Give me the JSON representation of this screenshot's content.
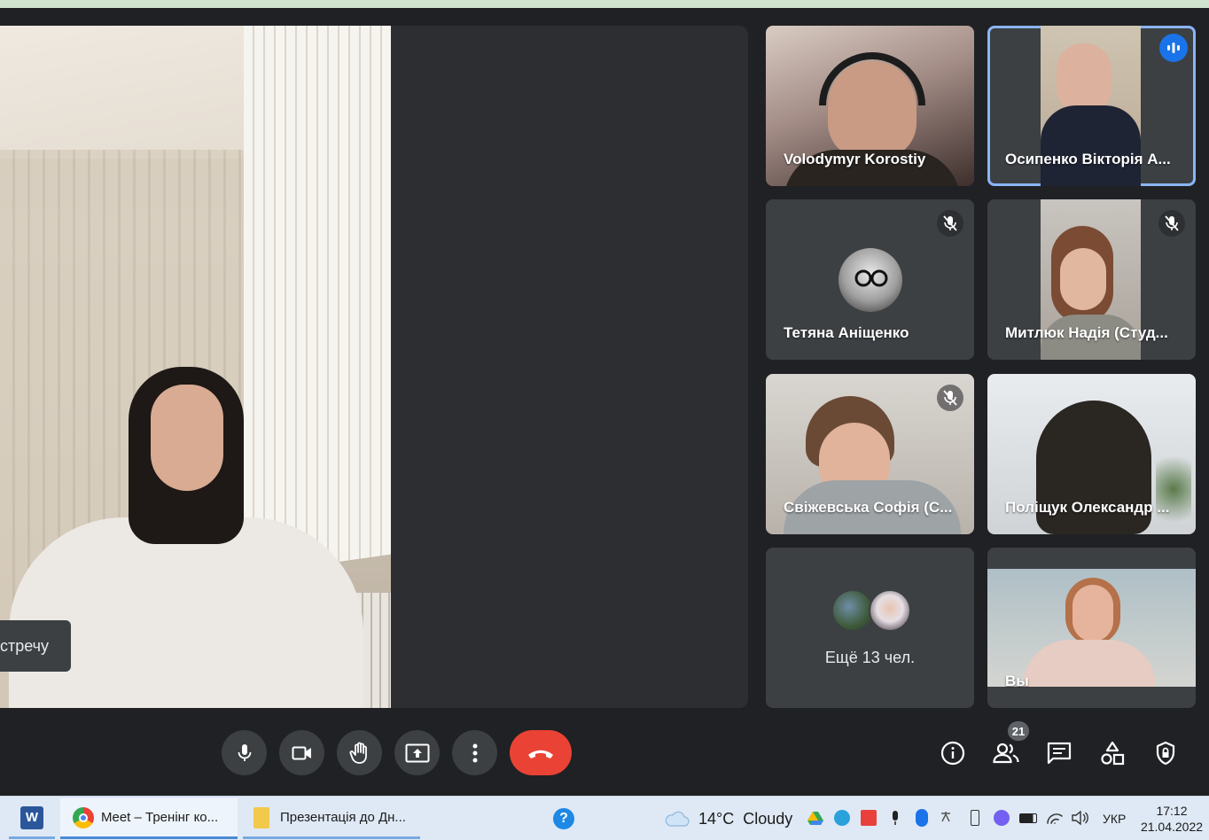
{
  "main_stage": {
    "caption_partial": "стречу"
  },
  "tiles": [
    {
      "name": "Volodymyr Korostiy",
      "muted": false,
      "speaking": false
    },
    {
      "name": "Осипенко Вікторія А...",
      "muted": false,
      "speaking": true
    },
    {
      "name": "Тетяна Аніщенко",
      "muted": true,
      "speaking": false
    },
    {
      "name": "Митлюк Надія (Студ...",
      "muted": true,
      "speaking": false
    },
    {
      "name": "Свіжевська Софія (С...",
      "muted": true,
      "speaking": false
    },
    {
      "name": "Поліщук Олександр ...",
      "muted": false,
      "speaking": false
    },
    {
      "name": "Ещё 13 чел.",
      "muted": false,
      "speaking": false
    },
    {
      "name": "Вы",
      "muted": false,
      "speaking": false
    }
  ],
  "controls": {
    "left": [
      "mic-icon",
      "camera-icon",
      "raise-hand-icon",
      "present-screen-icon",
      "more-options-icon"
    ],
    "hangup": "end-call-icon",
    "right": [
      "info-icon",
      "people-icon",
      "chat-icon",
      "activities-icon",
      "host-controls-icon"
    ],
    "participant_count": "21"
  },
  "colors": {
    "background": "#202124",
    "tile": "#3c4043",
    "hangup": "#ea4335",
    "active_outline": "#8ab4f8",
    "speaking_badge": "#1a73e8"
  },
  "taskbar": {
    "apps": [
      {
        "icon": "word-icon",
        "label": ""
      },
      {
        "icon": "chrome-icon",
        "label": "Meet – Тренінг ко..."
      },
      {
        "icon": "folder-icon",
        "label": "Презентація до Дн..."
      },
      {
        "icon": "help-icon",
        "label": ""
      }
    ],
    "weather": {
      "temp": "14°C",
      "condition": "Cloudy"
    },
    "language": "УКР",
    "time": "17:12",
    "date": "21.04.2022"
  }
}
